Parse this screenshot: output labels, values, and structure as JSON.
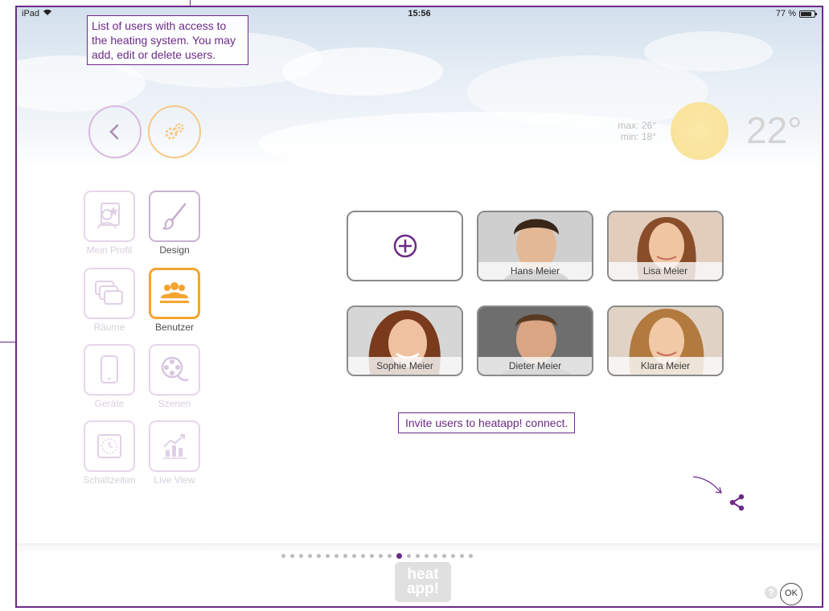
{
  "status_bar": {
    "device": "iPad",
    "time": "15:56",
    "battery": "77 %"
  },
  "weather": {
    "max": "max: 26°",
    "min": "min: 18°",
    "temperature": "22°"
  },
  "annotations": {
    "users_info": "List of users with access to the heating system. You may add, edit or delete users.",
    "invite": "Invite users to heatapp! connect."
  },
  "menu": {
    "items": [
      {
        "label": "Mein Profil",
        "icon": "profile-icon"
      },
      {
        "label": "Design",
        "icon": "brush-icon"
      },
      {
        "label": "Räume",
        "icon": "rooms-icon"
      },
      {
        "label": "Benutzer",
        "icon": "users-icon",
        "active": true
      },
      {
        "label": "Geräte",
        "icon": "tablet-icon"
      },
      {
        "label": "Szenen",
        "icon": "film-reel-icon"
      },
      {
        "label": "Schaltzeiten",
        "icon": "clock-icon"
      },
      {
        "label": "Live View",
        "icon": "chart-icon"
      }
    ]
  },
  "users": [
    {
      "name": "Hans Meier"
    },
    {
      "name": "Lisa Meier"
    },
    {
      "name": "Sophie Meier"
    },
    {
      "name": "Dieter Meier"
    },
    {
      "name": "Klara Meier"
    }
  ],
  "pagination": {
    "total": 22,
    "active_index": 13
  },
  "logo": {
    "line1": "heat",
    "line2": "app!"
  },
  "help_label": "?",
  "ok_label": "OK",
  "colors": {
    "accent": "#6c2a87",
    "active": "#f4a42f",
    "menu_disabled": "#e5d6ea",
    "sun": "#f9e39c"
  }
}
